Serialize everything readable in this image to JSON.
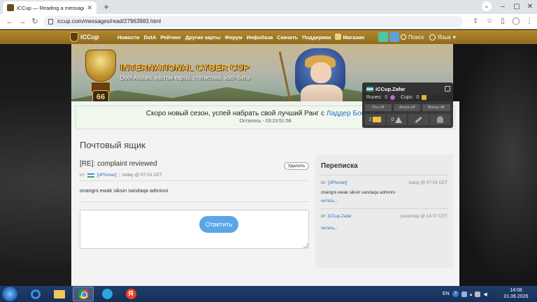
{
  "browser": {
    "tab_title": "iCCup — Reading a message fro",
    "new_tab": "+",
    "url": "iccup.com/messages/read/27963983.html"
  },
  "site": {
    "logo_text": "iCCup",
    "nav": [
      "Новости",
      "DotA",
      "Рейтинг",
      "Другие карты",
      "Форум",
      "Инфобаза",
      "Скачать",
      "Поддержка",
      "Магазин"
    ],
    "search_label": "Поиск",
    "lang_label": "Язык"
  },
  "banner": {
    "title": "INTERNATIONAL CYBER CUP",
    "subtitle": "DotA Allstars, кастом карты, статистика, хост-боты",
    "level": "66"
  },
  "user": {
    "name": "iCCup.Zafar",
    "runes_label": "Runes:",
    "runes_value": "0",
    "cups_label": "Cups:",
    "cups_value": "0",
    "pro_off": "Pro off",
    "armor_off": "Armor off",
    "bonus_off": "Bonus off",
    "mail_count": "2",
    "warn_count": "0"
  },
  "notice": {
    "text_before": "Скоро новый сезон, успей набрать свой лучший Ранг с ",
    "link": "Ладдер Бонусом",
    "text_after": " !",
    "timer_label": "Осталось - ",
    "timer": "03:23:51:58"
  },
  "mailbox": {
    "title": "Почтовый ящик",
    "subject": "[RE]: complaint reviewed",
    "delete_label": "Удалить",
    "from_label": "от:",
    "sender": "})iPhone({",
    "sent_time": "today @ 07:03 CET",
    "body": "onangni ewak siksin sandaqa adminni",
    "send_label": "Ответить"
  },
  "thread": {
    "title": "Переписка",
    "items": [
      {
        "from_label": "от:",
        "sender": "})iPhone({",
        "date": "today @ 07:03 CET",
        "body": "onangni ewak siksin sandaqa adminni",
        "read": "читать..."
      },
      {
        "from_label": "от:",
        "sender": "iCCup.Zafar",
        "date": "yesterday @ 14:07 CET",
        "body": "",
        "read": "читать..."
      }
    ]
  },
  "taskbar": {
    "lang": "EN",
    "time": "14:08",
    "date": "01.06.2026"
  }
}
